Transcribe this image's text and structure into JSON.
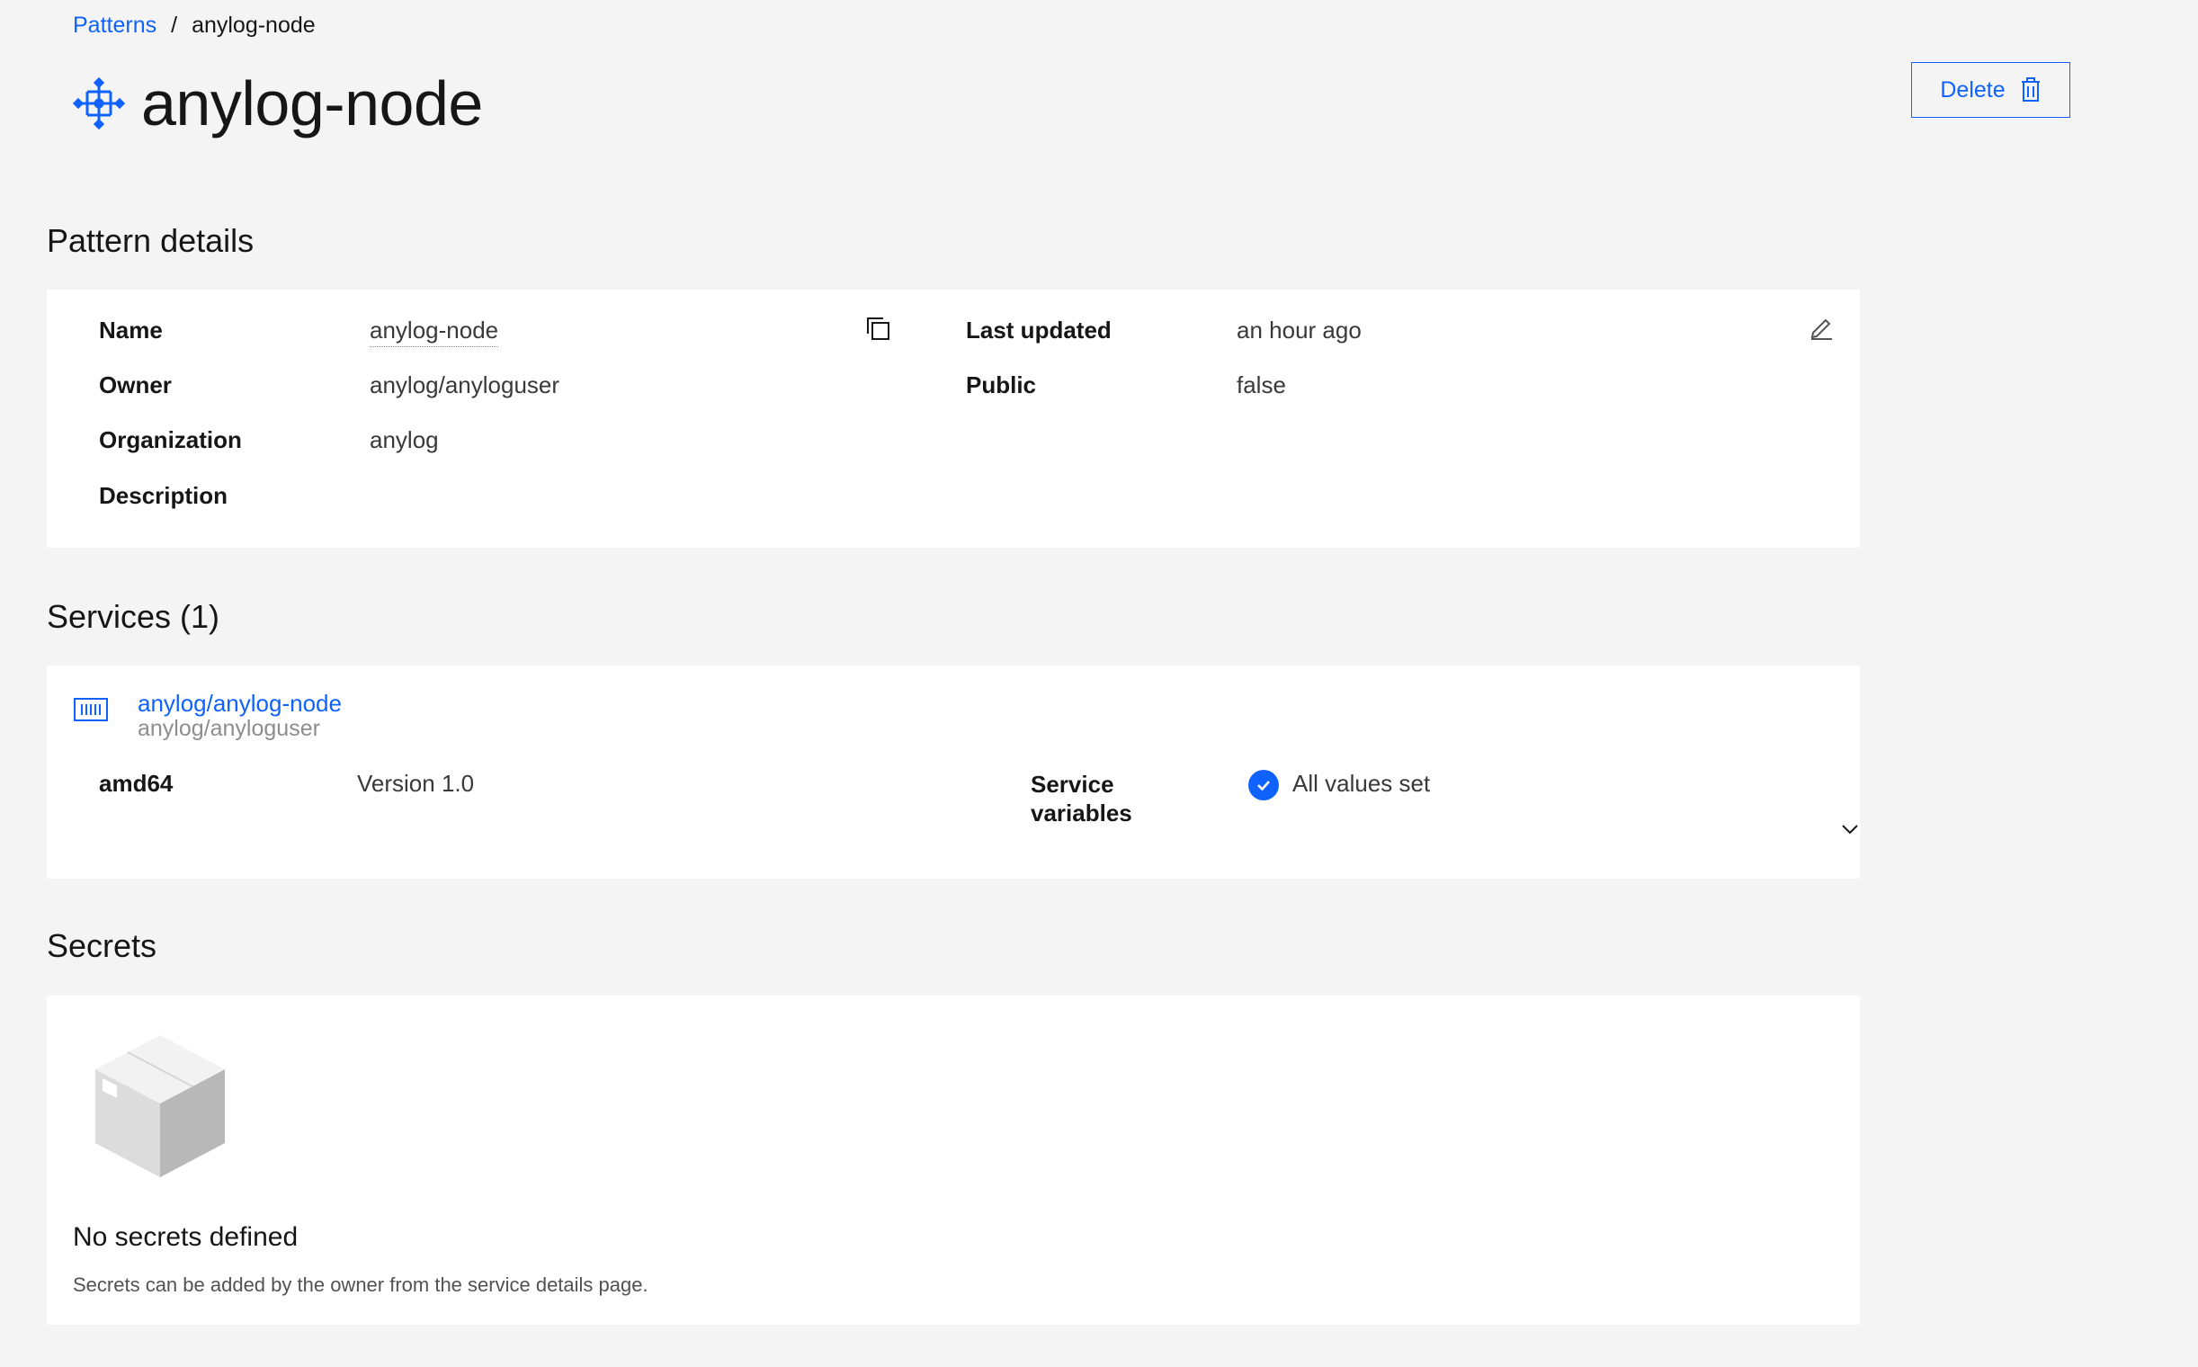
{
  "breadcrumb": {
    "parent": "Patterns",
    "separator": "/",
    "current": "anylog-node"
  },
  "header": {
    "title": "anylog-node",
    "title_icon": "pattern-icon",
    "delete_label": "Delete",
    "delete_icon": "trash-icon"
  },
  "pattern_details": {
    "heading": "Pattern details",
    "name_label": "Name",
    "name_value": "anylog-node",
    "owner_label": "Owner",
    "owner_value": "anylog/anyloguser",
    "organization_label": "Organization",
    "organization_value": "anylog",
    "description_label": "Description",
    "last_updated_label": "Last updated",
    "last_updated_value": "an hour ago",
    "public_label": "Public",
    "public_value": "false"
  },
  "services": {
    "heading": "Services (1)",
    "items": [
      {
        "name": "anylog/anylog-node",
        "owner": "anylog/anyloguser",
        "arch": "amd64",
        "version": "Version 1.0",
        "variables_label": "Service variables",
        "variables_status": "All values set"
      }
    ]
  },
  "secrets": {
    "heading": "Secrets",
    "empty_title": "No secrets defined",
    "empty_desc": "Secrets can be added by the owner from the service details page."
  },
  "colors": {
    "accent": "#0f62fe",
    "background": "#f4f4f4",
    "panel": "#ffffff"
  }
}
